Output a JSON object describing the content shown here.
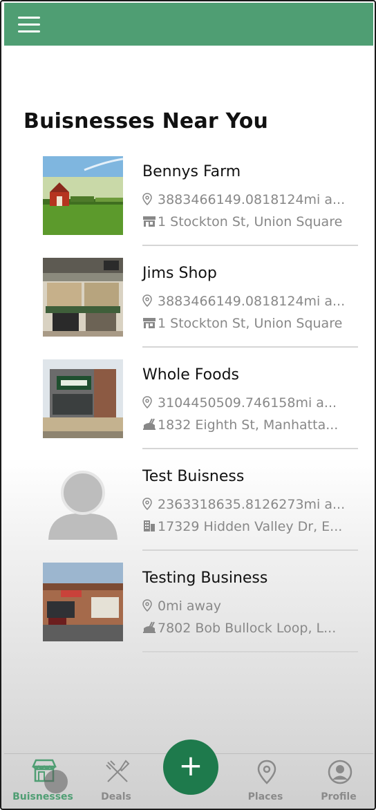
{
  "header": {
    "menu_icon": "hamburger-menu-icon",
    "color": "#4f9e73"
  },
  "title": "Buisnesses Near You",
  "businesses": [
    {
      "name": "Bennys Farm",
      "distance": "3883466149.0818124mi a...",
      "address": "1 Stockton St, Union Square",
      "address_icon": "store-icon",
      "image": "farm-barn-photo"
    },
    {
      "name": "Jims Shop",
      "distance": "3883466149.0818124mi a...",
      "address": "1 Stockton St, Union Square",
      "address_icon": "store-icon",
      "image": "grocery-interior-photo"
    },
    {
      "name": "Whole Foods",
      "distance": "3104450509.746158mi a...",
      "address": "1832 Eighth St, Manhatta...",
      "address_icon": "restaurant-icon",
      "image": "whole-foods-storefront-photo"
    },
    {
      "name": "Test Buisness",
      "distance": "2363318635.8126273mi a...",
      "address": "17329 Hidden Valley Dr, E...",
      "address_icon": "building-icon",
      "image": "default-avatar"
    },
    {
      "name": "Testing Business",
      "distance": "0mi away",
      "address": "7802 Bob Bullock Loop, L...",
      "address_icon": "restaurant-icon",
      "image": "shopping-center-photo"
    }
  ],
  "bottom_nav": {
    "items": [
      {
        "label": "Buisnesses",
        "icon": "storefront-icon",
        "active": true
      },
      {
        "label": "Deals",
        "icon": "utensils-icon",
        "active": false
      },
      {
        "label": "Places",
        "icon": "map-pin-icon",
        "active": false
      },
      {
        "label": "Profile",
        "icon": "user-circle-icon",
        "active": false
      }
    ],
    "fab_label": "+",
    "active_color": "#4f9e73",
    "fab_color": "#1e7a4c"
  }
}
